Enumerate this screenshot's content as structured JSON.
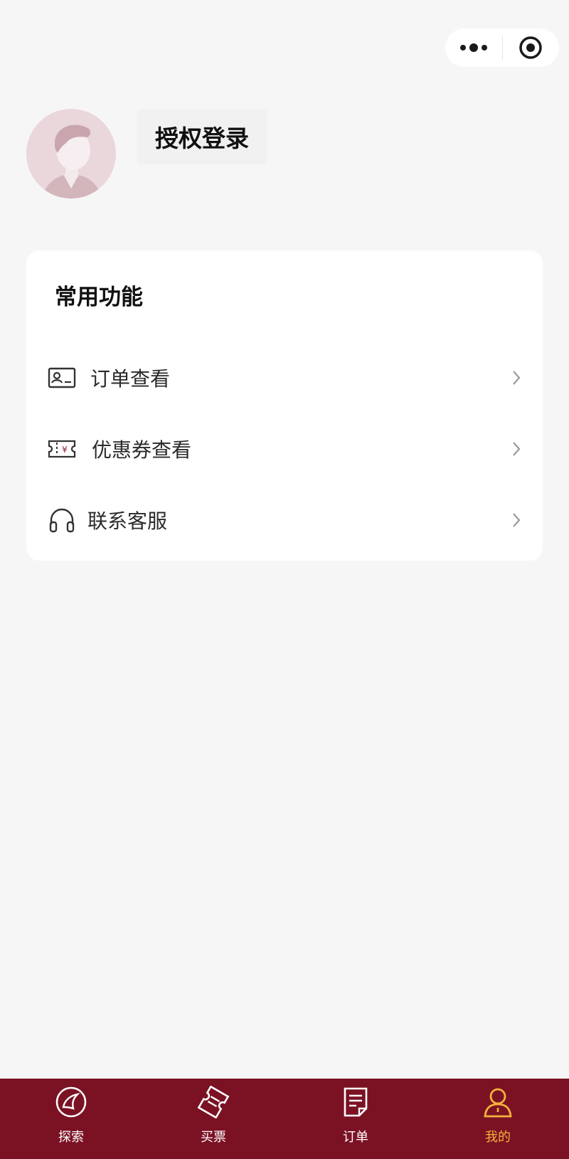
{
  "capsule": {
    "more_icon": "more-dots-icon",
    "close_icon": "target-circle-icon"
  },
  "profile": {
    "avatar_icon": "user-avatar-icon",
    "login_label": "授权登录"
  },
  "card": {
    "title": "常用功能",
    "items": [
      {
        "label": "订单查看",
        "icon": "id-card-icon"
      },
      {
        "label": "优惠券查看",
        "icon": "coupon-icon"
      },
      {
        "label": "联系客服",
        "icon": "headset-icon"
      }
    ]
  },
  "tabbar": {
    "items": [
      {
        "label": "探索",
        "icon": "explore-globe-icon",
        "active": false
      },
      {
        "label": "买票",
        "icon": "ticket-icon",
        "active": false
      },
      {
        "label": "订单",
        "icon": "order-doc-icon",
        "active": false
      },
      {
        "label": "我的",
        "icon": "person-icon",
        "active": true
      }
    ],
    "colors": {
      "background": "#7b1224",
      "active": "#f4b13a",
      "inactive": "#ffffff"
    }
  }
}
